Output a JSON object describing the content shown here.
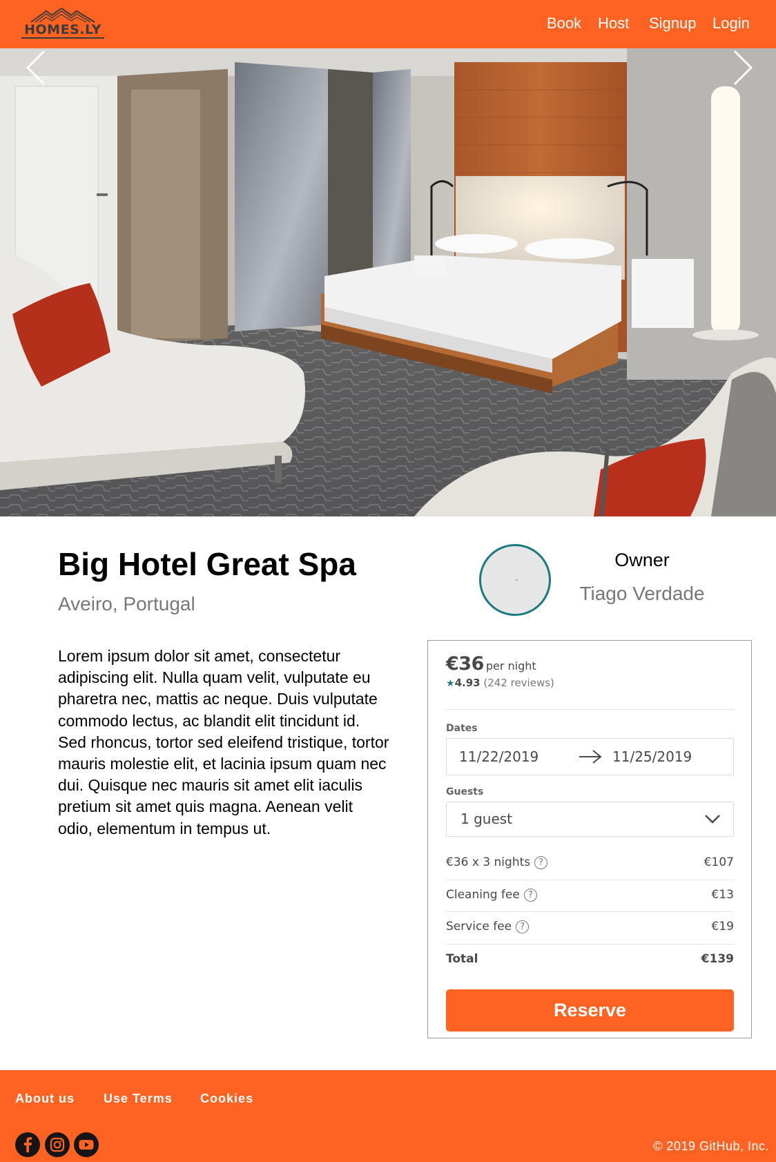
{
  "brand": {
    "logo_text": "HOMES.LY"
  },
  "nav": {
    "items": [
      "Book",
      "Host",
      "Signup",
      "Login"
    ]
  },
  "hero": {
    "image_alt": "Hotel room with bed, lounge chairs and floor lamp"
  },
  "listing": {
    "title": "Big Hotel Great Spa",
    "location": "Aveiro, Portugal",
    "description": "Lorem ipsum dolor sit amet, consectetur adipiscing elit. Nulla quam velit, vulputate eu pharetra nec, mattis ac neque. Duis vulputate commodo lectus, ac blandit elit tincidunt id. Sed rhoncus, tortor sed eleifend tristique, tortor mauris molestie elit, et lacinia ipsum quam nec dui. Quisque nec mauris sit amet elit iaculis pretium sit amet quis magna. Aenean velit odio, elementum in tempus ut."
  },
  "owner": {
    "label": "Owner",
    "name": "Tiago Verdade"
  },
  "booking": {
    "price": "€36",
    "price_unit": "per night",
    "rating_star": "★",
    "rating": "4.93",
    "reviews": "(242 reviews)",
    "dates_label": "Dates",
    "check_in": "11/22/2019",
    "check_out": "11/25/2019",
    "guests_label": "Guests",
    "guests": "1 guest",
    "fees": [
      {
        "label": "€36 x 3 nights",
        "value": "€107",
        "help": "?"
      },
      {
        "label": "Cleaning fee",
        "value": "€13",
        "help": "?"
      },
      {
        "label": "Service fee",
        "value": "€19",
        "help": "?"
      }
    ],
    "total_label": "Total",
    "total_value": "€139",
    "reserve_label": "Reserve"
  },
  "footer": {
    "links": [
      "About us",
      "Use Terms",
      "Cookies"
    ],
    "social": [
      "facebook-icon",
      "instagram-icon",
      "youtube-icon"
    ],
    "copyright": "© 2019 GitHub, Inc."
  },
  "colors": {
    "brand": "#ff6322",
    "accent": "#1a7a80",
    "text_muted": "#777777"
  }
}
